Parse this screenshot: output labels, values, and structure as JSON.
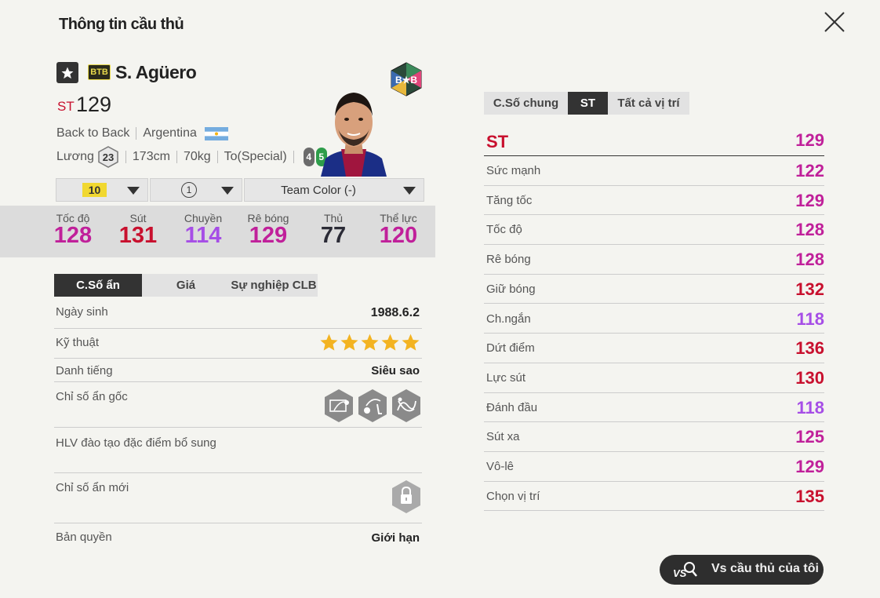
{
  "window": {
    "title": "Thông tin cầu thủ"
  },
  "player": {
    "season_code": "BTB",
    "season_logo_text": "B★B",
    "name": "S. Agüero",
    "position": "ST",
    "ovr": "129",
    "season_name": "Back to Back",
    "nation": "Argentina",
    "salary_label": "Lương",
    "salary": "23",
    "height": "173cm",
    "weight": "70kg",
    "body_type": "To(Special)",
    "weak_foot": "4",
    "strong_foot": "5"
  },
  "selectors": {
    "upgrade_level": "10",
    "team_skill": "1",
    "team_color": "Team Color (-)"
  },
  "summary_stats": [
    {
      "label": "Tốc độ",
      "value": "128",
      "color": "#c0209a"
    },
    {
      "label": "Sút",
      "value": "131",
      "color": "#c8102e"
    },
    {
      "label": "Chuyền",
      "value": "114",
      "color": "#a64ee6"
    },
    {
      "label": "Rê bóng",
      "value": "129",
      "color": "#c0209a"
    },
    {
      "label": "Thủ",
      "value": "77",
      "color": "#2b2b36"
    },
    {
      "label": "Thể lực",
      "value": "120",
      "color": "#c0209a"
    }
  ],
  "left_tabs": [
    "C.Số ẩn",
    "Giá",
    "Sự nghiệp CLB"
  ],
  "info": {
    "birth_label": "Ngày sinh",
    "birth": "1988.6.2",
    "skill_label": "Kỹ thuật",
    "skill_stars": 5,
    "rep_label": "Danh tiếng",
    "rep": "Siêu sao",
    "traits_label": "Chỉ số ẩn gốc",
    "traits_icons": [
      "chip-shot-icon",
      "outside-foot-shot-icon",
      "flair-passes-icon"
    ],
    "coach_label": "HLV đào tạo đặc điểm bổ sung",
    "new_traits_label": "Chỉ số ẩn mới",
    "license_label": "Bản quyền",
    "license": "Giới hạn"
  },
  "right_tabs": [
    "C.Số chung",
    "ST",
    "Tất cả vị trí"
  ],
  "position_stats": [
    {
      "label": "ST",
      "value": "129",
      "color": "#c0209a"
    },
    {
      "label": "Sức mạnh",
      "value": "122",
      "color": "#c0209a"
    },
    {
      "label": "Tăng tốc",
      "value": "129",
      "color": "#c0209a"
    },
    {
      "label": "Tốc độ",
      "value": "128",
      "color": "#c0209a"
    },
    {
      "label": "Rê bóng",
      "value": "128",
      "color": "#c0209a"
    },
    {
      "label": "Giữ bóng",
      "value": "132",
      "color": "#c8102e"
    },
    {
      "label": "Ch.ngắn",
      "value": "118",
      "color": "#a64ee6"
    },
    {
      "label": "Dứt điểm",
      "value": "136",
      "color": "#c8102e"
    },
    {
      "label": "Lực sút",
      "value": "130",
      "color": "#c8102e"
    },
    {
      "label": "Đánh đầu",
      "value": "118",
      "color": "#a64ee6"
    },
    {
      "label": "Sút xa",
      "value": "125",
      "color": "#c0209a"
    },
    {
      "label": "Vô-lê",
      "value": "129",
      "color": "#c0209a"
    },
    {
      "label": "Chọn vị trí",
      "value": "135",
      "color": "#c8102e"
    }
  ],
  "compare_button": {
    "icon_text": "VS",
    "label": "Vs cầu thủ của tôi"
  }
}
